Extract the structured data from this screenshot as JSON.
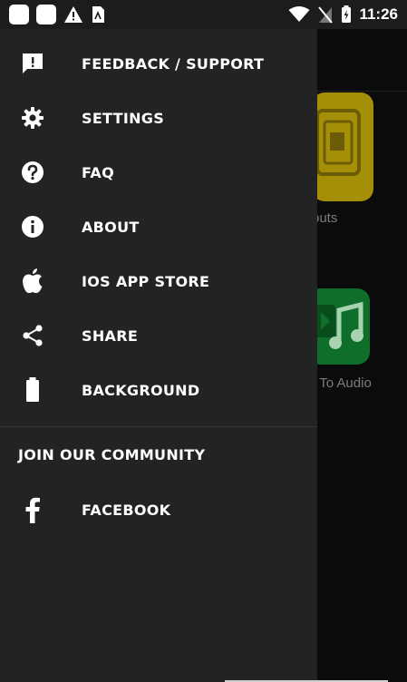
{
  "status_bar": {
    "time": "11:26",
    "icons": [
      "app-notification-icon",
      "app-notification-icon",
      "warning-icon",
      "sim-card-icon",
      "wifi-icon",
      "no-sim-icon",
      "battery-charging-icon"
    ]
  },
  "background_app": {
    "tile_1_label": "puts",
    "tile_2_label": "o To Audio",
    "tile_1_color": "#a58f08",
    "tile_2_color": "#0f6f2a"
  },
  "drawer": {
    "items": [
      {
        "label": "FEEDBACK / SUPPORT",
        "icon": "feedback-icon"
      },
      {
        "label": "SETTINGS",
        "icon": "gear-icon"
      },
      {
        "label": "FAQ",
        "icon": "help-icon"
      },
      {
        "label": "ABOUT",
        "icon": "info-icon"
      },
      {
        "label": "IOS APP STORE",
        "icon": "apple-icon"
      },
      {
        "label": "SHARE",
        "icon": "share-icon"
      },
      {
        "label": "BACKGROUND",
        "icon": "battery-icon"
      }
    ],
    "community_title": "JOIN OUR COMMUNITY",
    "community_items": [
      {
        "label": "FACEBOOK",
        "icon": "facebook-icon"
      }
    ],
    "background_color": "#232323"
  }
}
